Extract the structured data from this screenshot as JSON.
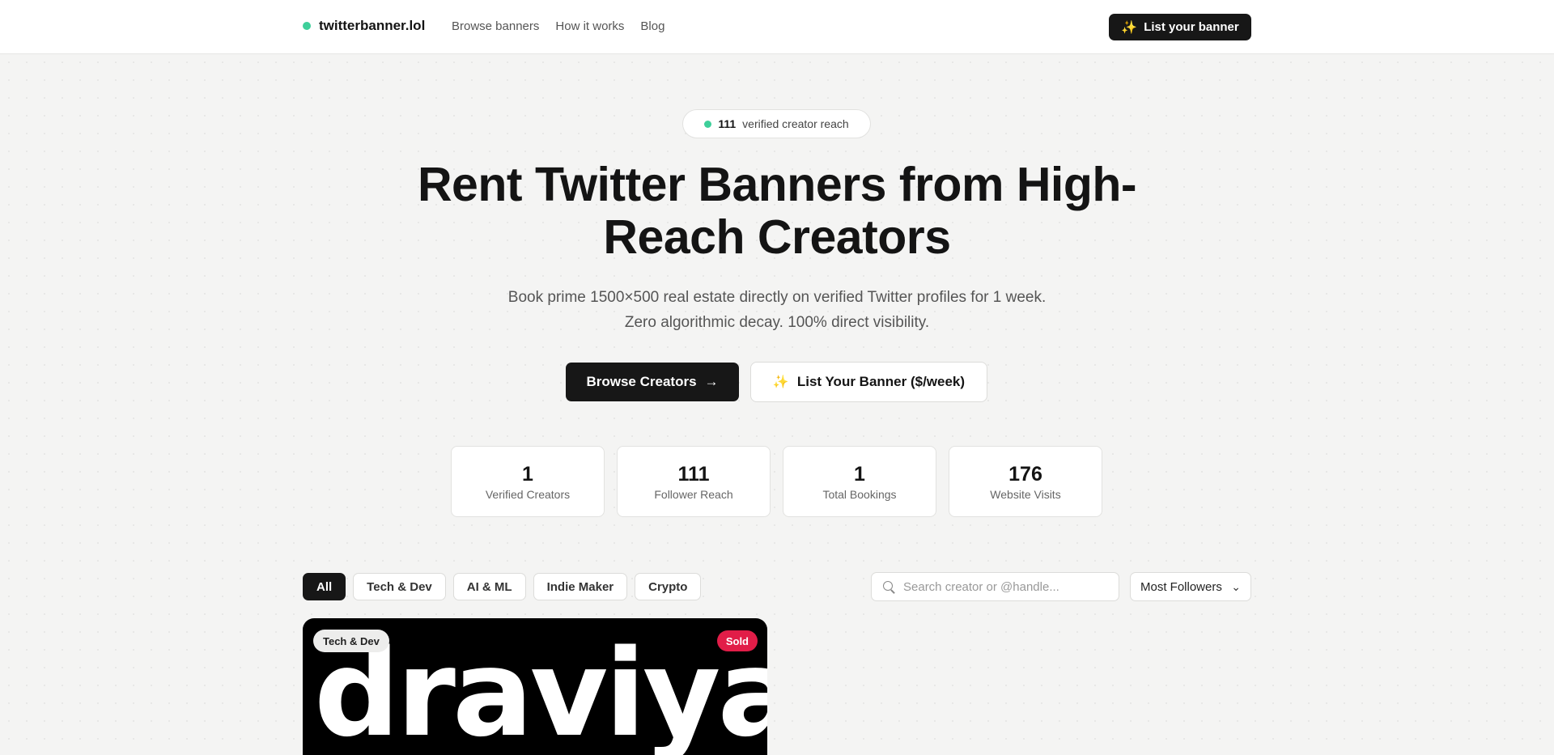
{
  "header": {
    "brand": "twitterbanner.lol",
    "nav": [
      "Browse banners",
      "How it works",
      "Blog"
    ],
    "cta": "List your banner"
  },
  "hero": {
    "pill_count": "111",
    "pill_text": "verified creator reach",
    "title": "Rent Twitter Banners from High-Reach Creators",
    "subtitle": "Book prime 1500×500 real estate directly on verified Twitter profiles for 1 week. Zero algorithmic decay. 100% direct visibility.",
    "primary_button": "Browse Creators",
    "secondary_button": "List Your Banner ($/week)"
  },
  "stats": [
    {
      "value": "1",
      "label": "Verified Creators"
    },
    {
      "value": "111",
      "label": "Follower Reach"
    },
    {
      "value": "1",
      "label": "Total Bookings"
    },
    {
      "value": "176",
      "label": "Website Visits"
    }
  ],
  "filters": {
    "categories": [
      "All",
      "Tech & Dev",
      "AI & ML",
      "Indie Maker",
      "Crypto"
    ],
    "search_placeholder": "Search creator or @handle...",
    "sort_selected": "Most Followers"
  },
  "cards": [
    {
      "category": "Tech & Dev",
      "status": "Sold",
      "banner_text": "draviya."
    }
  ],
  "colors": {
    "accent_green": "#3ecf9a",
    "primary_dark": "#171717",
    "sold_red": "#e11d48",
    "spark_amber": "#f4b23a"
  }
}
